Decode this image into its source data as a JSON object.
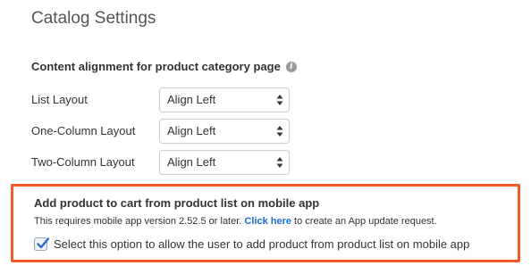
{
  "page": {
    "title": "Catalog Settings"
  },
  "content_alignment": {
    "heading": "Content alignment for product category page",
    "rows": [
      {
        "label": "List Layout",
        "value": "Align Left"
      },
      {
        "label": "One-Column Layout",
        "value": "Align Left"
      },
      {
        "label": "Two-Column Layout",
        "value": "Align Left"
      }
    ]
  },
  "mobile_cart": {
    "heading": "Add product to cart from product list on mobile app",
    "note_before": "This requires mobile app version 2.52.5 or later. ",
    "note_link": "Click here",
    "note_after": " to create an App update request.",
    "checkbox_label": "Select this option to allow the user to add product from product list on mobile app",
    "checked": true,
    "highlight_color": "#f15a22",
    "link_color": "#1a6ed8"
  },
  "icons": {
    "info": "info-icon",
    "select_arrows": "chevron-up-down-icon",
    "check": "checkmark-icon"
  }
}
